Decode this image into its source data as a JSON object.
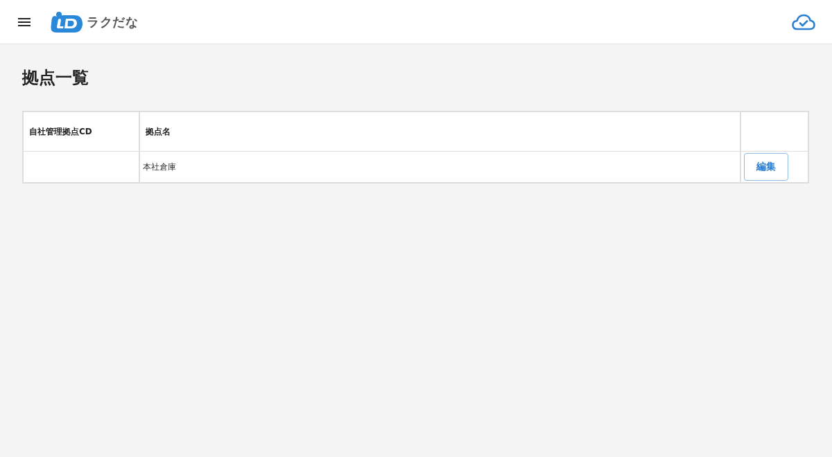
{
  "header": {
    "logo_text": "ラクだな"
  },
  "page_title": "拠点一覧",
  "table": {
    "columns": [
      "自社管理拠点CD",
      "拠点名"
    ],
    "rows": [
      {
        "site_name": "本社倉庫",
        "edit_button": "編集"
      }
    ]
  }
}
